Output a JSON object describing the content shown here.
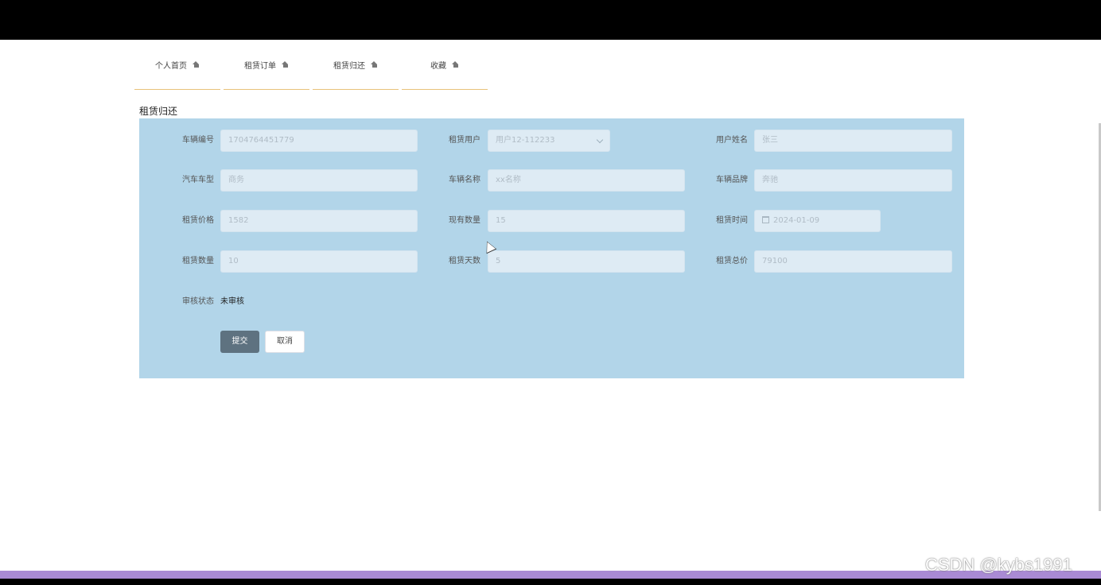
{
  "tabs": [
    {
      "label": "个人首页",
      "icon": "home-icon"
    },
    {
      "label": "租赁订单",
      "icon": "home-icon"
    },
    {
      "label": "租赁归还",
      "icon": "home-icon"
    },
    {
      "label": "收藏",
      "icon": "home-icon"
    }
  ],
  "section_title": "租赁归还",
  "form": {
    "vehicle_no": {
      "label": "车辆编号",
      "value": "1704764451779"
    },
    "rent_user": {
      "label": "租赁用户",
      "value": "用户12-112233"
    },
    "user_name": {
      "label": "用户姓名",
      "value": "张三"
    },
    "car_model": {
      "label": "汽车车型",
      "value": "商务"
    },
    "car_name": {
      "label": "车辆名称",
      "value": "xx名称"
    },
    "car_brand": {
      "label": "车辆品牌",
      "value": "奔驰"
    },
    "rent_price": {
      "label": "租赁价格",
      "value": "1582"
    },
    "stock_qty": {
      "label": "现有数量",
      "value": "15"
    },
    "rent_time": {
      "label": "租赁时间",
      "value": "2024-01-09"
    },
    "rent_qty": {
      "label": "租赁数量",
      "value": "10"
    },
    "rent_days": {
      "label": "租赁天数",
      "value": "5"
    },
    "rent_total": {
      "label": "租赁总价",
      "value": "79100"
    },
    "review_status": {
      "label": "审核状态",
      "value": "未审核"
    }
  },
  "buttons": {
    "submit": "提交",
    "cancel": "取消"
  },
  "watermark": "CSDN @kybs1991",
  "colors": {
    "panel": "#b2d5e9",
    "submit": "#5e7280",
    "tab_underline": "#e8c27a"
  }
}
